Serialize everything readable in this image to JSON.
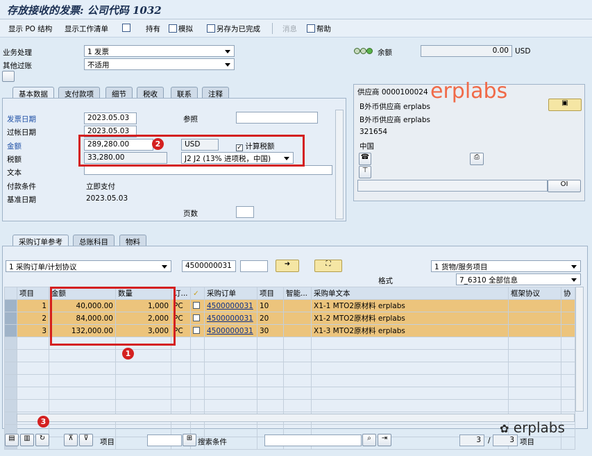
{
  "title": "存放接收的发票: 公司代码 1032",
  "toolbar": {
    "show_po": "显示 PO 结构",
    "show_worklist": "显示工作清单",
    "hold": "持有",
    "simulate": "模拟",
    "save_complete": "另存为已完成",
    "messages": "消息",
    "help": "帮助"
  },
  "header": {
    "transaction_label": "业务处理",
    "transaction_value": "1 发票",
    "other_posting_label": "其他过账",
    "other_posting_value": "不适用",
    "balance_label": "余额",
    "balance_value": "0.00",
    "balance_currency": "USD"
  },
  "top_tabs": [
    "基本数据",
    "支付款项",
    "细节",
    "税收",
    "联系",
    "注释"
  ],
  "basic": {
    "invoice_date_label": "发票日期",
    "invoice_date": "2023.05.03",
    "reference_label": "参照",
    "posting_date_label": "过帐日期",
    "posting_date": "2023.05.03",
    "amount_label": "金额",
    "amount": "289,280.00",
    "currency": "USD",
    "calc_tax_label": "计算税额",
    "tax_label": "税额",
    "tax": "33,280.00",
    "tax_code": "J2 J2 (13% 进项税，中国)",
    "text_label": "文本",
    "payment_terms_label": "付款条件",
    "payment_terms": "立即支付",
    "baseline_label": "基准日期",
    "baseline": "2023.05.03",
    "page_label": "页数"
  },
  "vendor": {
    "title": "供应商 0000100024",
    "line1": "B外币供应商 erplabs",
    "line2": "B外币供应商 erplabs",
    "line3": "321654",
    "line4": "中国",
    "oi": "OI"
  },
  "bottom_tabs": [
    "采购订单参考",
    "总账科目",
    "物料"
  ],
  "po_ref": {
    "ref_type": "1 采购订单/计划协议",
    "po_number": "4500000031",
    "item_type": "1 货物/服务项目",
    "format_label": "格式",
    "format": "7_6310 全部信息"
  },
  "grid": {
    "headers": [
      "项目",
      "金额",
      "数量",
      "订...",
      "",
      "采购订单",
      "项目",
      "智能...",
      "采购单文本",
      "框架协议",
      "协"
    ],
    "rows": [
      {
        "item": "1",
        "amount": "40,000.00",
        "qty": "1,000",
        "unit": "PC",
        "po": "4500000031",
        "po_item": "10",
        "text": "X1-1 MTO2原材料 erplabs"
      },
      {
        "item": "2",
        "amount": "84,000.00",
        "qty": "2,000",
        "unit": "PC",
        "po": "4500000031",
        "po_item": "20",
        "text": "X1-2 MTO2原材料 erplabs"
      },
      {
        "item": "3",
        "amount": "132,000.00",
        "qty": "3,000",
        "unit": "PC",
        "po": "4500000031",
        "po_item": "30",
        "text": "X1-3 MTO2原材料 erplabs"
      }
    ]
  },
  "footer": {
    "item_label": "项目",
    "search_label": "搜索条件",
    "page_current": "3",
    "page_sep": "/",
    "page_total": "3",
    "item_label2": "项目"
  },
  "annotations": {
    "a1": "1",
    "a2": "2",
    "a3": "3"
  },
  "watermark": {
    "top": "erplabs",
    "bottom": "erplabs"
  },
  "colors": {
    "highlight_row": "#ecc47c",
    "annotation": "#d42020",
    "watermark": "#f06a48"
  }
}
